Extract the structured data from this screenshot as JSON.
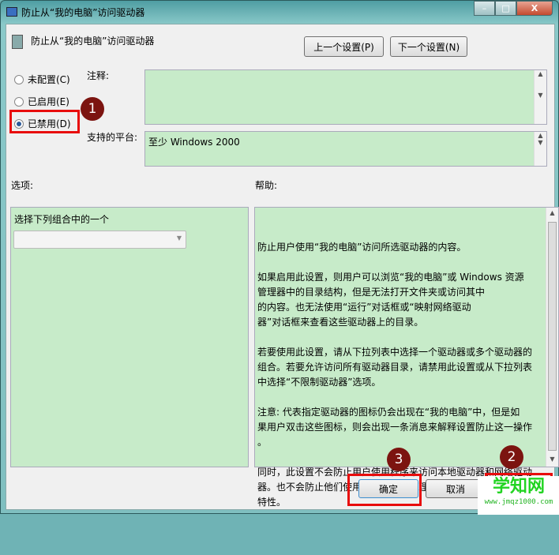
{
  "window": {
    "title": "防止从“我的电脑”访问驱动器",
    "minimize": "–",
    "maximize": "□",
    "close": "X"
  },
  "header": {
    "setting_name": "防止从“我的电脑”访问驱动器",
    "prev_button": "上一个设置(P)",
    "next_button": "下一个设置(N)"
  },
  "state": {
    "options": [
      {
        "label": "未配置(C)",
        "selected": false
      },
      {
        "label": "已启用(E)",
        "selected": false
      },
      {
        "label": "已禁用(D)",
        "selected": true
      }
    ]
  },
  "comment_label": "注释:",
  "platform_label": "支持的平台:",
  "platform_value": "至少 Windows 2000",
  "options_label": "选项:",
  "help_label": "帮助:",
  "options_panel": {
    "combo_label": "选择下列组合中的一个",
    "combo_value": ""
  },
  "help_text": "防止用户使用“我的电脑”访问所选驱动器的内容。\n\n如果启用此设置，则用户可以浏览“我的电脑”或 Windows 资源\n管理器中的目录结构，但是无法打开文件夹或访问其中\n的内容。也无法使用“运行”对话框或“映射网络驱动\n器”对话框来查看这些驱动器上的目录。\n\n若要使用此设置，请从下拉列表中选择一个驱动器或多个驱动器的\n组合。若要允许访问所有驱动器目录，请禁用此设置或从下拉列表\n中选择“不限制驱动器”选项。\n\n注意: 代表指定驱动器的图标仍会出现在“我的电脑”中，但是如\n果用户双击这些图标，则会出现一条消息来解释设置防止这一操作\n。\n\n同时，此设置不会防止用户使用程序来访问本地驱动器和网络驱动\n器。也不会防止他们使用“磁盘管理”管理单元查看并更改驱动器\n特性。",
  "footer": {
    "ok": "确定",
    "cancel": "取消"
  },
  "annotations": [
    "1",
    "2",
    "3"
  ],
  "watermark": {
    "name": "学知网",
    "url": "www.jmqz1000.com"
  }
}
